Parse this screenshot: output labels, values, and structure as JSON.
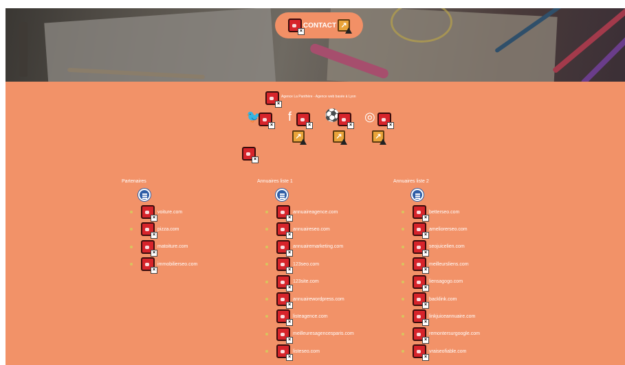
{
  "header": {
    "contact_label": "CONTACT"
  },
  "footer": {
    "tagline": "Agence La Panthère - Agence web basée à Lyon",
    "social": [
      {
        "name": "twitter-icon",
        "glyph": "🐦"
      },
      {
        "name": "facebook-icon",
        "glyph": "f"
      },
      {
        "name": "dribbble-icon",
        "glyph": "⚽"
      },
      {
        "name": "instagram-icon",
        "glyph": "◎"
      }
    ],
    "columns": [
      {
        "title": "Partenaires",
        "items": [
          "voiture.com",
          "pizza.com",
          "matoiture.com",
          "immobilierseo.com"
        ]
      },
      {
        "title": "Annuaires liste 1",
        "items": [
          "annuaireagence.com",
          "annuaireseo.com",
          "annuairemarketing.com",
          "123seo.com",
          "123site.com",
          "annuairewordpress.com",
          "listeagence.com",
          "meilleuresagencesparis.com",
          "listeseo.com"
        ]
      },
      {
        "title": "Annuaires liste 2",
        "items": [
          "betterseo.com",
          "ameliorerseo.com",
          "seojuicelien.com",
          "meilleursliens.com",
          "liensagogo.com",
          "backlink.com",
          "linkjuiceannuaire.com",
          "remontersurgoogle.com",
          "vraiseofiable.com"
        ]
      }
    ]
  }
}
